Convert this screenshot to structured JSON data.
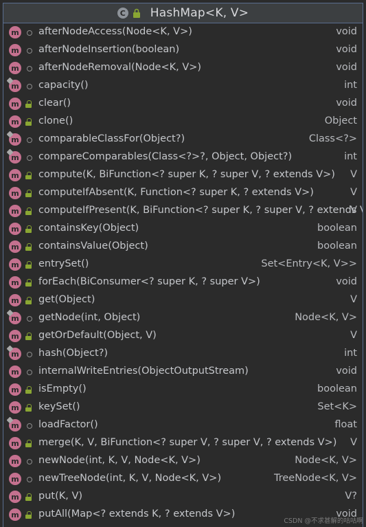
{
  "header": {
    "class_icon_letter": "C",
    "title": "HashMap<K, V>"
  },
  "methods": [
    {
      "name": "afterNodeAccess(Node<K, V>)",
      "returns": "void",
      "visibility": "package",
      "static": false
    },
    {
      "name": "afterNodeInsertion(boolean)",
      "returns": "void",
      "visibility": "package",
      "static": false
    },
    {
      "name": "afterNodeRemoval(Node<K, V>)",
      "returns": "void",
      "visibility": "package",
      "static": false
    },
    {
      "name": "capacity()",
      "returns": "int",
      "visibility": "package",
      "static": true
    },
    {
      "name": "clear()",
      "returns": "void",
      "visibility": "public",
      "static": false
    },
    {
      "name": "clone()",
      "returns": "Object",
      "visibility": "public",
      "static": false
    },
    {
      "name": "comparableClassFor(Object?)",
      "returns": "Class<?>",
      "visibility": "package",
      "static": true
    },
    {
      "name": "compareComparables(Class<?>?, Object, Object?)",
      "returns": "int",
      "visibility": "package",
      "static": true
    },
    {
      "name": "compute(K, BiFunction<? super K, ? super V, ? extends V>)",
      "returns": "V",
      "visibility": "public",
      "static": false
    },
    {
      "name": "computeIfAbsent(K, Function<? super K, ? extends V>)",
      "returns": "V",
      "visibility": "public",
      "static": false
    },
    {
      "name": "computeIfPresent(K, BiFunction<? super K, ? super V, ? extends V>)",
      "returns": "V",
      "visibility": "public",
      "static": false
    },
    {
      "name": "containsKey(Object)",
      "returns": "boolean",
      "visibility": "public",
      "static": false
    },
    {
      "name": "containsValue(Object)",
      "returns": "boolean",
      "visibility": "public",
      "static": false
    },
    {
      "name": "entrySet()",
      "returns": "Set<Entry<K, V>>",
      "visibility": "public",
      "static": false
    },
    {
      "name": "forEach(BiConsumer<? super K, ? super V>)",
      "returns": "void",
      "visibility": "public",
      "static": false
    },
    {
      "name": "get(Object)",
      "returns": "V",
      "visibility": "public",
      "static": false
    },
    {
      "name": "getNode(int, Object)",
      "returns": "Node<K, V>",
      "visibility": "package",
      "static": true
    },
    {
      "name": "getOrDefault(Object, V)",
      "returns": "V",
      "visibility": "public",
      "static": false
    },
    {
      "name": "hash(Object?)",
      "returns": "int",
      "visibility": "package",
      "static": true
    },
    {
      "name": "internalWriteEntries(ObjectOutputStream)",
      "returns": "void",
      "visibility": "package",
      "static": false
    },
    {
      "name": "isEmpty()",
      "returns": "boolean",
      "visibility": "public",
      "static": false
    },
    {
      "name": "keySet()",
      "returns": "Set<K>",
      "visibility": "public",
      "static": false
    },
    {
      "name": "loadFactor()",
      "returns": "float",
      "visibility": "package",
      "static": true
    },
    {
      "name": "merge(K, V, BiFunction<? super V, ? super V, ? extends V>)",
      "returns": "V",
      "visibility": "public",
      "static": false
    },
    {
      "name": "newNode(int, K, V, Node<K, V>)",
      "returns": "Node<K, V>",
      "visibility": "package",
      "static": false
    },
    {
      "name": "newTreeNode(int, K, V, Node<K, V>)",
      "returns": "TreeNode<K, V>",
      "visibility": "package",
      "static": false
    },
    {
      "name": "put(K, V)",
      "returns": "V?",
      "visibility": "public",
      "static": false
    },
    {
      "name": "putAll(Map<? extends K, ? extends V>)",
      "returns": "void",
      "visibility": "public",
      "static": false
    }
  ],
  "method_icon_letter": "m",
  "watermark": "CSDN @不求甚解的咕咕啊",
  "colors": {
    "method_icon": "#c5718f",
    "public_lock": "#8aa633",
    "border": "#5a6e90"
  }
}
